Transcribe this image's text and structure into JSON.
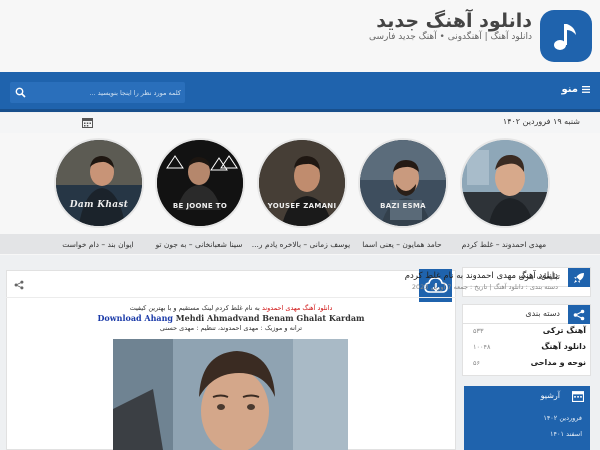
{
  "header": {
    "site_title": "دانلود آهنگ جدید",
    "site_description": "دانلود آهنگ | آهنگدونی • آهنگ جدید فارسی"
  },
  "navbar": {
    "menu_label": "منو",
    "search_placeholder": "کلمه مورد نظر را اینجا بنویسید ..."
  },
  "date": {
    "text": "شنبه ۱۹ فروردین ۱۴۰۲"
  },
  "singers": [
    {
      "caption": "مهدی احمدوند – غلط کردم",
      "art_label": ""
    },
    {
      "caption": "حامد همایون – یعنی اسما",
      "art_label": "BAZI ESMA"
    },
    {
      "caption": "یوسف زمانی – بالاخره یادم ر...",
      "art_label": "YOUSEF ZAMANI"
    },
    {
      "caption": "سینا شعبانخانی – به جون تو",
      "art_label": "BE JOONE TO"
    },
    {
      "caption": "ایوان بند – دام خواست",
      "art_label": "Dam Khast"
    }
  ],
  "sidebar": {
    "ads_title": "تبلیغات بنری",
    "categories_title": "دسته بندی",
    "categories": [
      {
        "name": "آهنگ ترکی",
        "count": "۵۳۳"
      },
      {
        "name": "دانلود آهنگ",
        "count": "۱۰۰۴۸"
      },
      {
        "name": "نوحه و مداحی",
        "count": "۵۶"
      }
    ],
    "archive_title": "آرشیو",
    "archive_items": [
      "فروردین ۱۴۰۲",
      "اسفند ۱۴۰۱"
    ]
  },
  "post": {
    "title": "دانلود آهنگ مهدی احمدوند به نام غلط کردم",
    "meta": "دسته بندی : دانلود آهنگ  |  تاریخ : جمعه 7 آوریل 2023",
    "intro_red": "دانلود آهنگ مهدی احمدوند",
    "intro_rest": " به نام غلط کردم لینک مستقیم و با بهترین کیفیت",
    "dl_blue": "Download Ahang",
    "dl_rest": " Mehdi Ahmadvand Benam Ghalat Kardam",
    "credit": "ترانه و موزیک : مهدی احمدوند، تنظیم : مهدی حسنی"
  },
  "colors": {
    "brand": "#1f63ad",
    "highlight_red": "#d01414",
    "link_blue": "#1a3aa8"
  },
  "icons": {
    "logo": "music-note-icon",
    "menu": "hamburger-icon",
    "search": "search-icon",
    "date": "calendar-icon",
    "ads": "rocket-icon",
    "categories": "share-icon",
    "archive": "calendar-icon",
    "post": "cloud-download-icon",
    "share": "share-icon"
  }
}
